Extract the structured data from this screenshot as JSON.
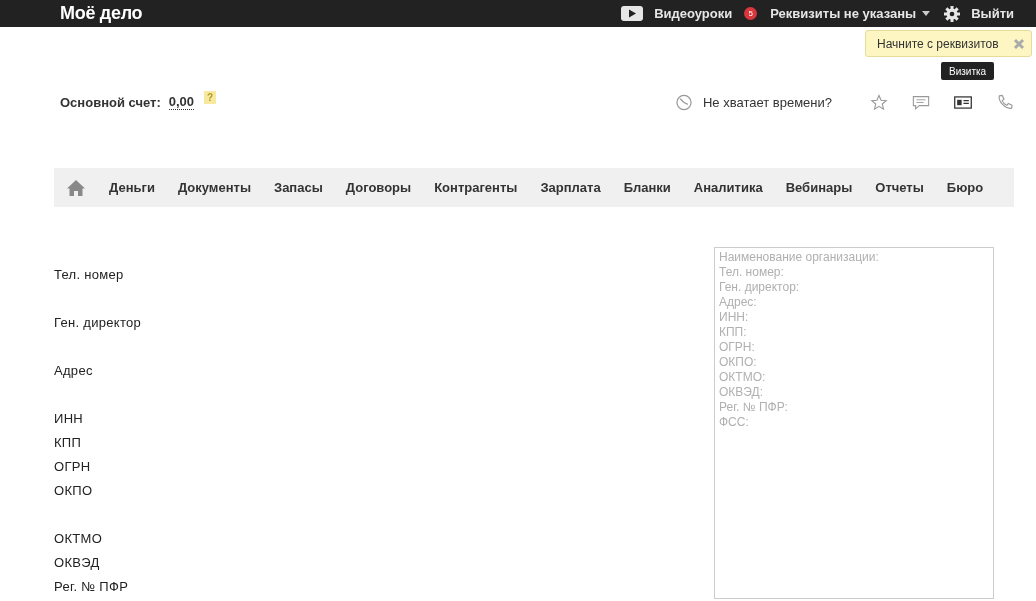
{
  "topbar": {
    "logo": "Моё дело",
    "video_lessons": "Видеоуроки",
    "notification_count": "5",
    "requisites_menu": "Реквизиты не указаны",
    "logout": "Выйти"
  },
  "hint_popup": {
    "text": "Начните с реквизитов"
  },
  "account": {
    "label": "Основной счет:",
    "amount": "0,00",
    "help": "?"
  },
  "toolbar": {
    "time_link": "Не хватает времени?",
    "card_tooltip": "Визитка"
  },
  "nav": [
    "Деньги",
    "Документы",
    "Запасы",
    "Договоры",
    "Контрагенты",
    "Зарплата",
    "Бланки",
    "Аналитика",
    "Вебинары",
    "Отчеты",
    "Бюро"
  ],
  "field_groups": [
    {
      "fields": [
        "Тел. номер"
      ]
    },
    {
      "fields": [
        "Ген. директор"
      ]
    },
    {
      "fields": [
        "Адрес"
      ]
    },
    {
      "fields": [
        "ИНН",
        "КПП",
        "ОГРН",
        "ОКПО"
      ]
    },
    {
      "fields": [
        "ОКТМО",
        "ОКВЭД",
        "Рег. № ПФР"
      ]
    }
  ],
  "preview": {
    "placeholder": [
      "Наименование организации:",
      "Тел. номер:",
      "Ген. директор:",
      "Адрес:",
      "ИНН:",
      "КПП:",
      "ОГРН:",
      "ОКПО:",
      "ОКТМО:",
      "ОКВЭД:",
      "Рег. № ПФР:",
      "ФСС:"
    ]
  }
}
